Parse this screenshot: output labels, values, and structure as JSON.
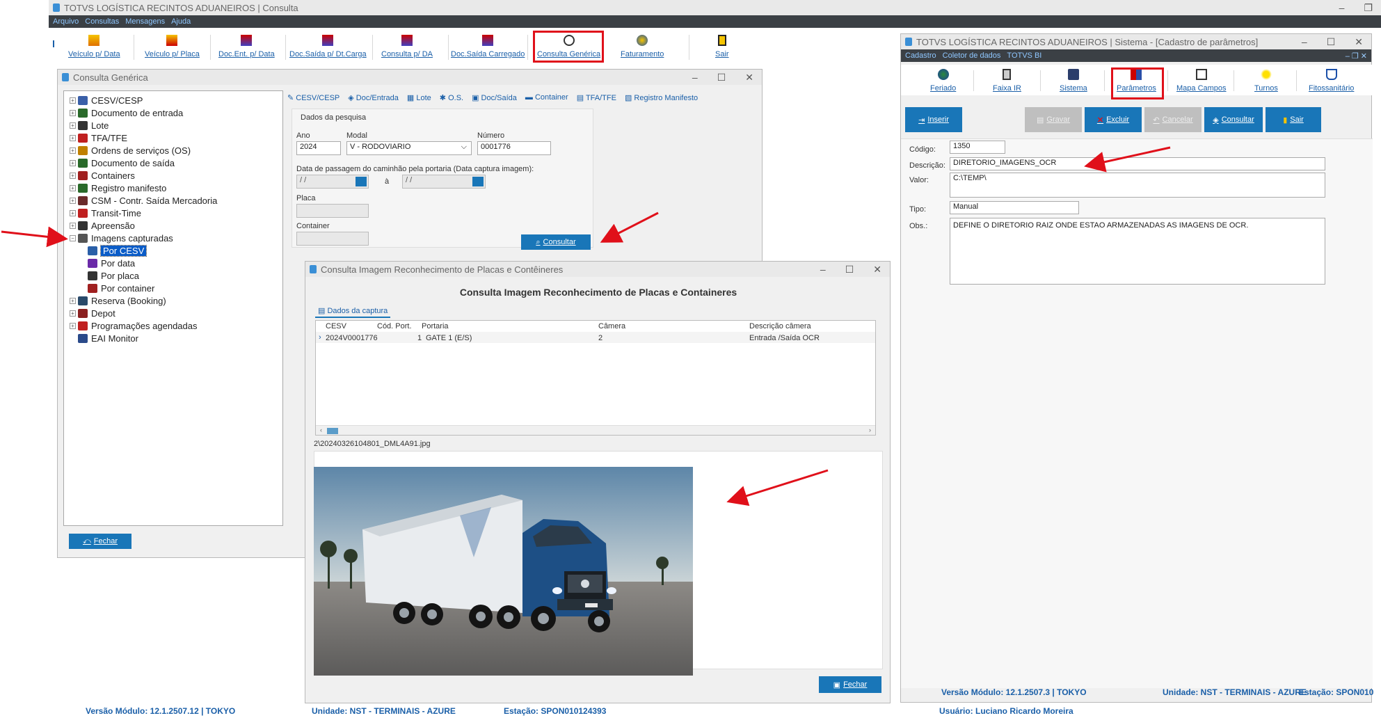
{
  "main": {
    "title": "TOTVS LOGÍSTICA RECINTOS ADUANEIROS | Consulta",
    "menu": [
      "Arquivo",
      "Consultas",
      "Mensagens",
      "Ajuda"
    ],
    "toolbar": [
      "Veículo p/ Data",
      "Veículo p/ Placa",
      "Doc.Ent. p/ Data",
      "Doc.Saída p/ Dt.Carga",
      "Consulta p/ DA",
      "Doc.Saída Carregado",
      "Consulta Genérica",
      "Faturamento",
      "Sair"
    ],
    "status": {
      "versao": "Versão Módulo:  12.1.2507.12  |  TOKYO",
      "unidade": "Unidade: NST - TERMINAIS - AZURE",
      "estacao": "Estação: SPON010124393",
      "usuario": "Usuário: Luciano Ricardo Moreira"
    }
  },
  "generic": {
    "title": "Consulta Genérica",
    "tree": [
      "CESV/CESP",
      "Documento de entrada",
      "Lote",
      "TFA/TFE",
      "Ordens de serviços (OS)",
      "Documento de saída",
      "Containers",
      "Registro manifesto",
      "CSM - Contr. Saída Mercadoria",
      "Transit-Time",
      "Apreensão",
      "Imagens capturadas",
      "Por CESV",
      "Por data",
      "Por placa",
      "Por container",
      "Reserva (Booking)",
      "Depot",
      "Programações agendadas",
      "EAI Monitor"
    ],
    "tabs": [
      "CESV/CESP",
      "Doc/Entrada",
      "Lote",
      "O.S.",
      "Doc/Saída",
      "Container",
      "TFA/TFE",
      "Registro Manifesto"
    ],
    "group": "Dados da pesquisa",
    "ano_label": "Ano",
    "ano": "2024",
    "modal_label": "Modal",
    "modal": "V - RODOVIARIO",
    "numero_label": "Número",
    "numero": "0001776",
    "data_label": "Data de passagem do caminhão pela portaria (Data captura imagem):",
    "date_empty": "/ /",
    "a": "à",
    "placa_label": "Placa",
    "container_label": "Container",
    "consultar": "Consultar",
    "fechar": "Fechar"
  },
  "ocr": {
    "title": "Consulta Imagem Reconhecimento de Placas e Contêineres",
    "heading": "Consulta Imagem Reconhecimento de Placas e Containeres",
    "tab": "Dados da captura",
    "cols": [
      "CESV",
      "Cód. Port.",
      "Portaria",
      "Câmera",
      "Descrição câmera"
    ],
    "row": [
      "2024V0001776",
      "1",
      "GATE 1 (E/S)",
      "2",
      "Entrada /Saída OCR"
    ],
    "file": "2\\20240326104801_DML4A91.jpg",
    "fechar": "Fechar"
  },
  "params": {
    "title": "TOTVS LOGÍSTICA RECINTOS ADUANEIROS | Sistema - [Cadastro de parâmetros]",
    "menu": [
      "Cadastro",
      "Coletor de dados",
      "TOTVS BI"
    ],
    "toolbar": [
      "Feriado",
      "Faixa IR",
      "Sistema",
      "Parâmetros",
      "Mapa Campos",
      "Turnos",
      "Fitossanitário"
    ],
    "actions": [
      "Inserir",
      "Gravar",
      "Excluir",
      "Cancelar",
      "Consultar",
      "Sair"
    ],
    "codigo_label": "Código:",
    "codigo": "1350",
    "descricao_label": "Descrição:",
    "descricao": "DIRETORIO_IMAGENS_OCR",
    "valor_label": "Valor:",
    "valor": "C:\\TEMP\\",
    "tipo_label": "Tipo:",
    "tipo": "Manual",
    "obs_label": "Obs.:",
    "obs": "DEFINE O DIRETORIO RAIZ ONDE ESTAO ARMAZENADAS AS IMAGENS DE OCR.",
    "versao": "Versão Módulo:   12.1.2507.3  |  TOKYO",
    "unidade": "Unidade: NST - TERMINAIS - AZURE",
    "estacao": "Estação: SPON010"
  },
  "colors": {
    "accent": "#1976b8",
    "highlight": "#e0101a",
    "menubar": "#3b4045"
  }
}
